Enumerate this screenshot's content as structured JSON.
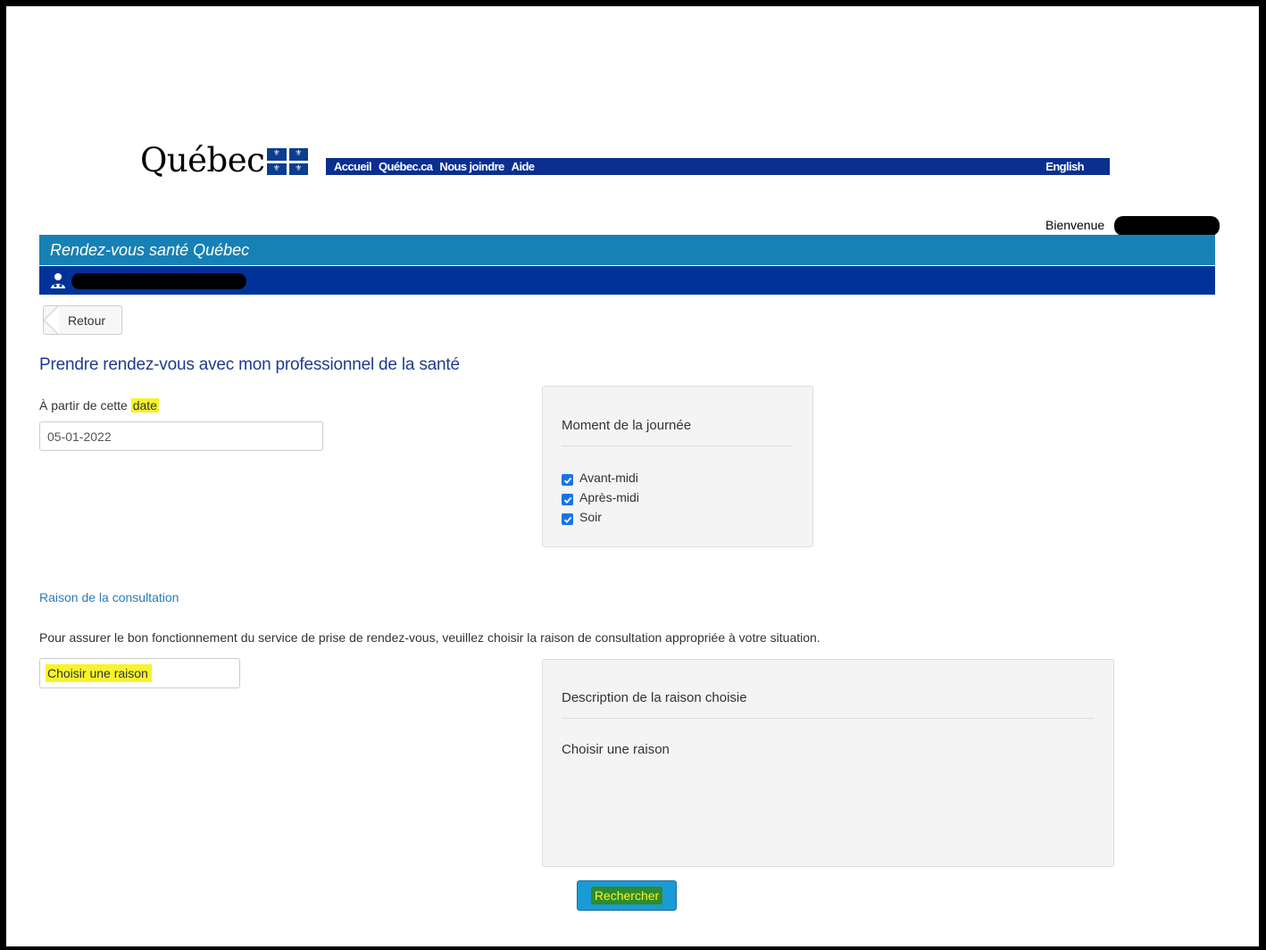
{
  "header": {
    "logo_text": "Québec",
    "nav": [
      "Accueil",
      "Québec.ca",
      "Nous joindre",
      "Aide"
    ],
    "language": "English",
    "welcome": "Bienvenue"
  },
  "app": {
    "title": "Rendez-vous santé Québec"
  },
  "back_button": "Retour",
  "page_title": "Prendre rendez-vous avec mon professionnel de la santé",
  "date_section": {
    "label_prefix": "À partir de cette",
    "label_highlight": "date",
    "value": "05-01-2022"
  },
  "time_of_day": {
    "title": "Moment de la journée",
    "options": [
      {
        "label": "Avant-midi",
        "checked": true
      },
      {
        "label": "Après-midi",
        "checked": true
      },
      {
        "label": "Soir",
        "checked": true
      }
    ]
  },
  "reason": {
    "title": "Raison de la consultation",
    "help": "Pour assurer le bon fonctionnement du service de prise de rendez-vous, veuillez choisir la raison de consultation appropriée à votre situation.",
    "select_value": "Choisir une raison",
    "panel_title": "Description de la raison choisie",
    "panel_body": "Choisir une raison"
  },
  "search_button": "Rechercher",
  "colors": {
    "topnav": "#0b2f8f",
    "appbar": "#1781b5",
    "userbar": "#003399",
    "highlight": "#f7f32c",
    "title_blue": "#1f3b8f",
    "button": "#1a9bd6"
  }
}
